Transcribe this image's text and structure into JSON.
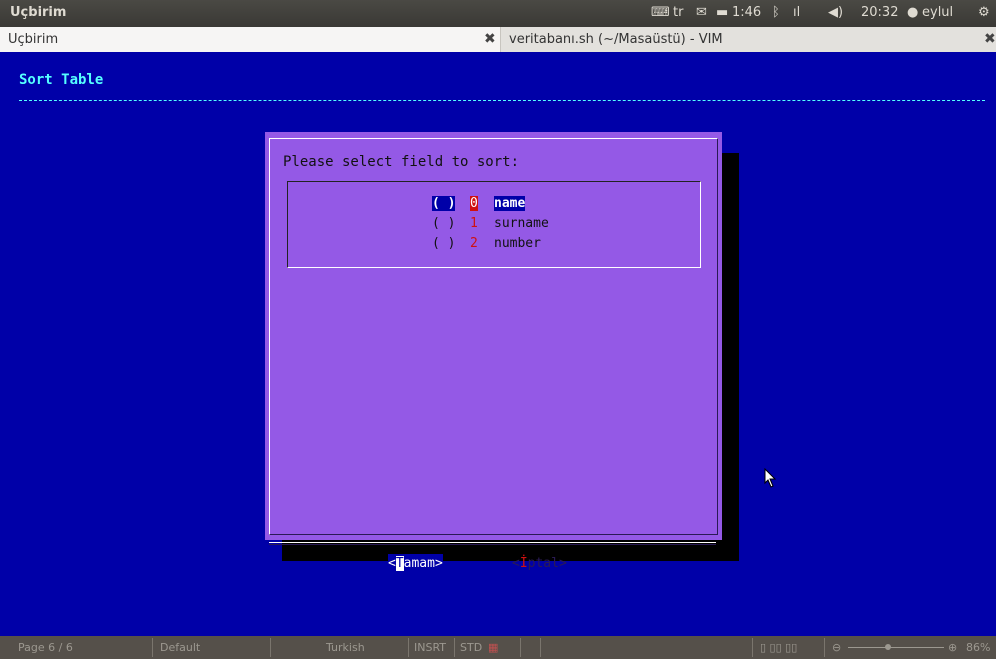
{
  "topbar": {
    "app_title": "Uçbirim",
    "keyboard_layout": "tr",
    "battery": "1:46",
    "time": "20:32",
    "user": "eylul"
  },
  "tabs": [
    {
      "label": "Uçbirim",
      "active": true
    },
    {
      "label": "veritabanı.sh (~/Masaüstü) - VIM",
      "active": false
    }
  ],
  "terminal": {
    "backtitle": "Sort Table",
    "dialog": {
      "prompt": "Please select field to sort:",
      "options": [
        {
          "radio": "( )",
          "tag": "0",
          "item": "name",
          "selected": true
        },
        {
          "radio": "( )",
          "tag": "1",
          "item": "surname",
          "selected": false
        },
        {
          "radio": "( )",
          "tag": "2",
          "item": "number",
          "selected": false
        }
      ],
      "ok_button": {
        "open": "<",
        "hotkey": "T",
        "rest": "amam>"
      },
      "cancel_button": {
        "open": "<",
        "hotkey": "İ",
        "rest": "ptal>"
      }
    }
  },
  "statusbar": {
    "page": "Page 6 / 6",
    "style": "Default",
    "language": "Turkish",
    "insert_mode": "INSRT",
    "selection_mode": "STD",
    "zoom": "86%"
  },
  "colors": {
    "terminal_bg": "#0000a8",
    "dialog_bg": "#9459e6",
    "backtitle": "#55ffff",
    "highlight": "#d01010"
  }
}
